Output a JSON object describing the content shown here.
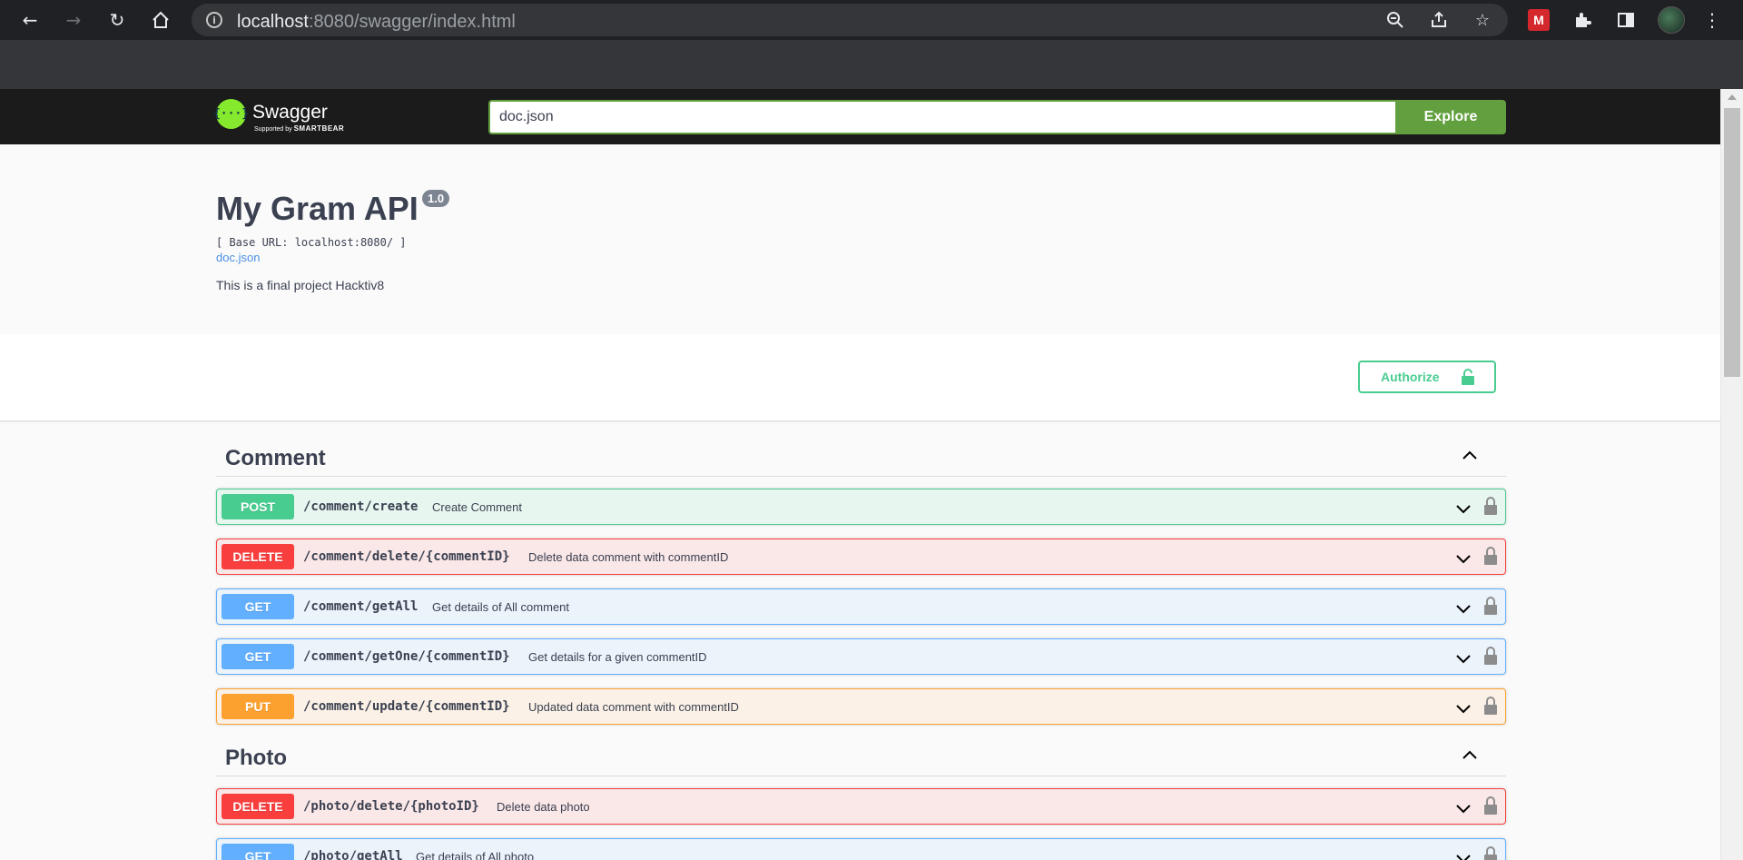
{
  "browser": {
    "url_host": "localhost",
    "url_rest": ":8080/swagger/index.html",
    "ext_label": "M"
  },
  "topbar": {
    "logo_mark": "{···}",
    "logo_text": "Swagger",
    "logo_sub_prefix": "Supported by ",
    "logo_sub_brand": "SMARTBEAR",
    "spec_url": "doc.json",
    "explore_label": "Explore"
  },
  "info": {
    "title": "My Gram API",
    "version": "1.0",
    "base_url": "[ Base URL: localhost:8080/ ]",
    "doc_link": "doc.json",
    "description": "This is a final project Hacktiv8"
  },
  "auth": {
    "authorize_label": "Authorize"
  },
  "tags": [
    {
      "name": "Comment",
      "operations": [
        {
          "method": "POST",
          "path": "/comment/create",
          "summary": "Create Comment"
        },
        {
          "method": "DELETE",
          "path": "/comment/delete/{commentID}",
          "summary": "Delete data comment with commentID"
        },
        {
          "method": "GET",
          "path": "/comment/getAll",
          "summary": "Get details of All comment"
        },
        {
          "method": "GET",
          "path": "/comment/getOne/{commentID}",
          "summary": "Get details for a given commentID"
        },
        {
          "method": "PUT",
          "path": "/comment/update/{commentID}",
          "summary": "Updated data comment with commentID"
        }
      ]
    },
    {
      "name": "Photo",
      "operations": [
        {
          "method": "DELETE",
          "path": "/photo/delete/{photoID}",
          "summary": "Delete data photo"
        },
        {
          "method": "GET",
          "path": "/photo/getAll",
          "summary": "Get details of All photo"
        }
      ]
    }
  ],
  "colors": {
    "post": "#49cc90",
    "delete": "#f93e3e",
    "get": "#61affe",
    "put": "#fca130",
    "explore": "#62a03f"
  }
}
